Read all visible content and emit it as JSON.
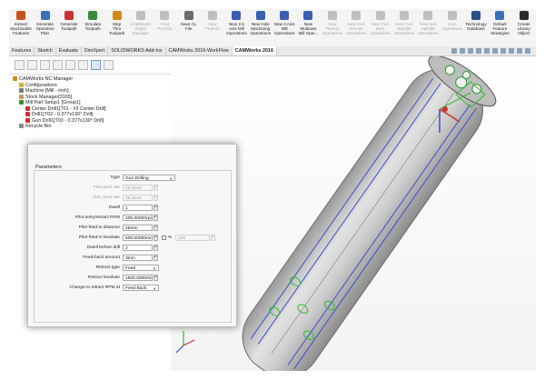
{
  "ribbon": [
    {
      "label": "Extract\nMachinable\nFeatures",
      "color": "#c8521c",
      "disabled": false
    },
    {
      "label": "Generate\nOperation\nPlan",
      "color": "#3b6fb6",
      "disabled": false
    },
    {
      "label": "Generate\nToolpath",
      "color": "#c83232",
      "disabled": false
    },
    {
      "label": "Simulate\nToolpath",
      "color": "#3b8a3b",
      "disabled": false
    },
    {
      "label": "Step\nThru\nToolpath",
      "color": "#d08a1c",
      "disabled": false
    },
    {
      "label": "CAMWorks\nRapid\nManager",
      "color": "#bfbfbf",
      "disabled": true
    },
    {
      "label": "Post\nProcess",
      "color": "#bfbfbf",
      "disabled": true
    },
    {
      "label": "Save CL\nFile",
      "color": "#6a6a6a",
      "disabled": false
    },
    {
      "label": "New\nFeature",
      "color": "#bfbfbf",
      "disabled": true
    },
    {
      "label": "New 2.5\nAxis Mill\nOperations",
      "color": "#3b5fb0",
      "disabled": false
    },
    {
      "label": "New Hole\nMachining\nOperations",
      "color": "#3b5fb0",
      "disabled": false
    },
    {
      "label": "New 3 Axis\nMill\nOperations",
      "color": "#3b5fb0",
      "disabled": false
    },
    {
      "label": "New\nMultiaxis\nMill Oper...",
      "color": "#3b5fb0",
      "disabled": false
    },
    {
      "label": "New\nTurning\nOperations",
      "color": "#bfbfbf",
      "disabled": true
    },
    {
      "label": "New Turn\nGroove\nOperations",
      "color": "#bfbfbf",
      "disabled": true
    },
    {
      "label": "New Turn\nBore\nOperations",
      "color": "#bfbfbf",
      "disabled": true
    },
    {
      "label": "New Turn\nSpindle\nOperations",
      "color": "#bfbfbf",
      "disabled": true
    },
    {
      "label": "New Sub\nSpindle\nOperations",
      "color": "#bfbfbf",
      "disabled": true
    },
    {
      "label": "Sort\nOperations",
      "color": "#bfbfbf",
      "disabled": true
    },
    {
      "label": "Technology\nDatabase",
      "color": "#2a4f8a",
      "disabled": false
    },
    {
      "label": "Default\nFeature\nStrategies",
      "color": "#3b6fb6",
      "disabled": false
    },
    {
      "label": "Create\nLibrary\nObject",
      "color": "#2a2a2a",
      "disabled": false
    }
  ],
  "tabs": [
    {
      "label": "Features",
      "active": false
    },
    {
      "label": "Sketch",
      "active": false
    },
    {
      "label": "Evaluate",
      "active": false
    },
    {
      "label": "DimXpert",
      "active": false
    },
    {
      "label": "SOLIDWORKS Add-Ins",
      "active": false
    },
    {
      "label": "CAMWorks 2016-WorkFlow",
      "active": false
    },
    {
      "label": "CAMWorks 2016",
      "active": true
    }
  ],
  "tree": [
    {
      "label": "CAMWorks NC Manager",
      "indent": 0,
      "color": "#d08a1c"
    },
    {
      "label": "Configurations",
      "indent": 1,
      "color": "#d0b040"
    },
    {
      "label": "Machine [Mill - inch]",
      "indent": 1,
      "color": "#7a7a7a"
    },
    {
      "label": "Stock Manager[3165]",
      "indent": 1,
      "color": "#c89a5a"
    },
    {
      "label": "Mill Part Setup1 [Group1]",
      "indent": 1,
      "color": "#3b8a3b"
    },
    {
      "label": "Center Drill1[T01 - #3 Center Drill]",
      "indent": 2,
      "color": "#c83232"
    },
    {
      "label": "Drill1[T02 - 0.377x130° Drill]",
      "indent": 2,
      "color": "#c83232"
    },
    {
      "label": "Gun Drill1[T03 - 0.377x130° Drill]",
      "indent": 2,
      "color": "#c83232"
    },
    {
      "label": "Recycle Bin",
      "indent": 1,
      "color": "#8a8a8a"
    }
  ],
  "params": {
    "title": "Parameters",
    "type": {
      "label": "Type",
      "value": "Gun Drilling"
    },
    "first_peck": {
      "label": "First peck am",
      "value": "25.4mm"
    },
    "sub_peck": {
      "label": "Sub. peck am",
      "value": "25.4mm"
    },
    "dwell": {
      "label": "Dwell",
      "value": "1"
    },
    "pilot_rpm": {
      "label": "Pilot entry/retract RPM",
      "value": "200.00000rpm"
    },
    "pilot_dist": {
      "label": "Pilot feed-in distance",
      "value": "25mm"
    },
    "pilot_feed": {
      "label": "Pilot feed-in feedrate",
      "value": "500.00000mm"
    },
    "pct": {
      "label": "%",
      "value": "100"
    },
    "dwell_drill": {
      "label": "Dwell before drill",
      "value": "2"
    },
    "feedback": {
      "label": "Feed-back amount",
      "value": "3mm"
    },
    "retract_type": {
      "label": "Retract type",
      "value": "Feed"
    },
    "retract_feed": {
      "label": "Retract feedrate",
      "value": "1500.00000mm"
    },
    "change_rpm": {
      "label": "Change to retract RPM at",
      "value": "Feed Back"
    }
  }
}
